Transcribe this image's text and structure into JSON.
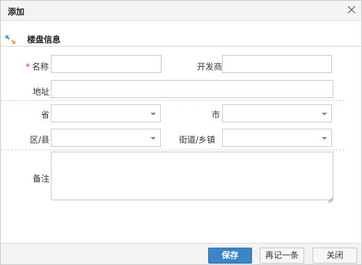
{
  "dialog": {
    "title": "添加",
    "close_icon": "close-icon"
  },
  "section": {
    "title": "楼盘信息",
    "icon": "expand-arrows-icon"
  },
  "fields": {
    "name": {
      "label": "名称",
      "required_mark": "*",
      "value": ""
    },
    "developer": {
      "label": "开发商",
      "value": ""
    },
    "address": {
      "label": "地址",
      "value": ""
    },
    "province": {
      "label": "省",
      "value": ""
    },
    "city": {
      "label": "市",
      "value": ""
    },
    "district": {
      "label": "区/县",
      "value": ""
    },
    "street": {
      "label": "街道/乡镇",
      "value": ""
    },
    "remark": {
      "label": "备注",
      "value": ""
    }
  },
  "buttons": {
    "save": "保存",
    "save_again": "再记一条",
    "close": "关闭"
  },
  "colors": {
    "primary": "#3b86c6",
    "required": "#d9262c",
    "icon_blue": "#4a8fc8",
    "icon_orange": "#e8a33a"
  }
}
